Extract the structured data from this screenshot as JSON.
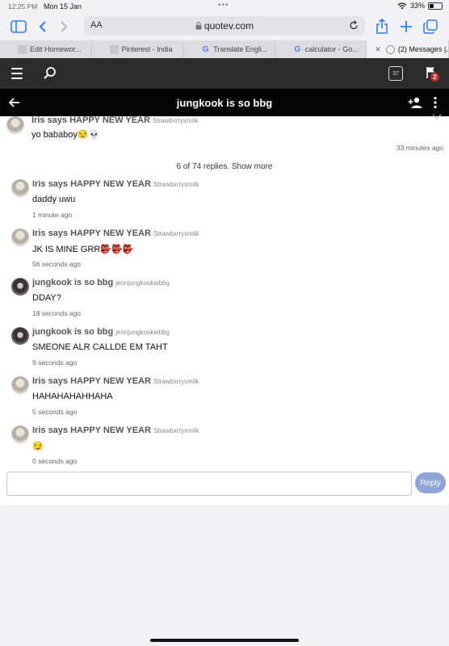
{
  "status": {
    "time": "12:25 PM",
    "date": "Mon 15 Jan",
    "battery_text": "33%",
    "battery_level": 0.33
  },
  "browser": {
    "url": "quotev.com",
    "aa": "AA",
    "tabs": [
      {
        "label": "Edit Homewor...",
        "icon": "page-icon"
      },
      {
        "label": "Pinterest - India",
        "icon": "page-icon"
      },
      {
        "label": "Translate Engli...",
        "icon": "google-icon"
      },
      {
        "label": "calculator - Go...",
        "icon": "google-icon"
      },
      {
        "label": "(2) Messages |...",
        "icon": "loading-icon",
        "active": true
      }
    ]
  },
  "sitenav": {
    "notifications": "37",
    "flag_count": "2"
  },
  "thread": {
    "title": "jungkook is so bbg"
  },
  "first_comment": {
    "name": "Iris says HAPPY NEW YEAR",
    "handle": "Strawbxrryxmilk",
    "text": "yo bababoy😒💀",
    "time": "33 minutes ago"
  },
  "show_more": "6 of 74 replies. Show more",
  "replies": [
    {
      "avatar": "iris",
      "name": "Iris says HAPPY NEW YEAR",
      "handle": "Strawbxrryxmilk",
      "text": "daddy uwu",
      "time": "1 minute ago"
    },
    {
      "avatar": "iris",
      "name": "Iris says HAPPY NEW YEAR",
      "handle": "Strawbxrryxmilk",
      "text": "JK IS MINE GRR👺👺👺",
      "time": "56 seconds ago"
    },
    {
      "avatar": "jk",
      "name": "jungkook is so bbg",
      "handle": "jeonjungkookiebbg",
      "text": "DDAY?",
      "time": "18 seconds ago"
    },
    {
      "avatar": "jk",
      "name": "jungkook is so bbg",
      "handle": "jeonjungkookiebbg",
      "text": "SMEONE ALR CALLDE EM TAHT",
      "time": "9 seconds ago"
    },
    {
      "avatar": "iris",
      "name": "Iris says HAPPY NEW YEAR",
      "handle": "Strawbxrryxmilk",
      "text": "HAHAHAHAHHAHA",
      "time": "5 seconds ago"
    },
    {
      "avatar": "iris",
      "name": "Iris says HAPPY NEW YEAR",
      "handle": "Strawbxrryxmilk",
      "text": "😏",
      "time": "0 seconds ago"
    }
  ],
  "reply": {
    "value": "",
    "placeholder": "",
    "button_label": "Reply"
  }
}
